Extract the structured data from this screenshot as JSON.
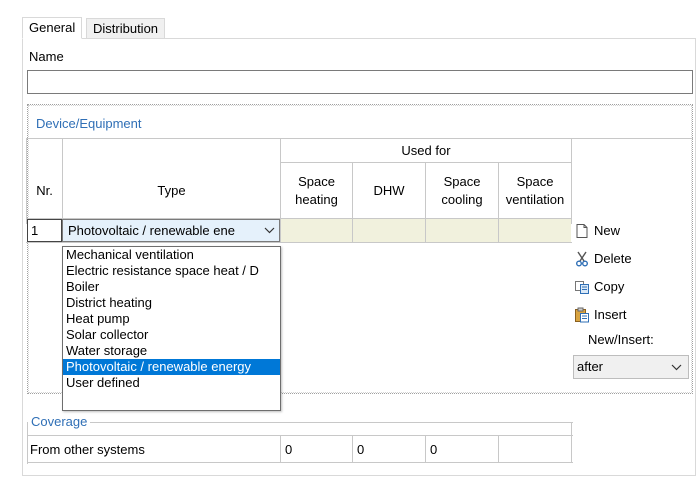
{
  "tabs": [
    {
      "label": "General"
    },
    {
      "label": "Distribution"
    }
  ],
  "name_label": "Name",
  "name_value": "",
  "device_group": {
    "title": "Device/Equipment",
    "headers": {
      "nr": "Nr.",
      "type": "Type",
      "used_for": "Used for",
      "space_heating": "Space heating",
      "dhw": "DHW",
      "space_cooling": "Space cooling",
      "space_ventilation": "Space ventilation"
    },
    "rows": [
      {
        "nr": "1",
        "type": "Photovoltaic / renewable ene"
      }
    ],
    "dropdown_options": [
      "Mechanical ventilation",
      "Electric resistance space heat / D",
      "Boiler",
      "District heating",
      "Heat pump",
      "Solar collector",
      "Water storage",
      "Photovoltaic / renewable energy",
      "User defined"
    ],
    "selected_option_index": 7
  },
  "side_actions": {
    "new": "New",
    "delete": "Delete",
    "copy": "Copy",
    "insert": "Insert",
    "new_insert_label": "New/Insert:",
    "new_insert_value": "after"
  },
  "coverage_group": {
    "title": "Coverage",
    "row_label": "From other systems",
    "values": [
      "0",
      "0",
      "0"
    ]
  },
  "colors": {
    "accent_blue": "#2f6fb6",
    "selection": "#0078d7",
    "cell_fill": "#f1f1dd"
  }
}
